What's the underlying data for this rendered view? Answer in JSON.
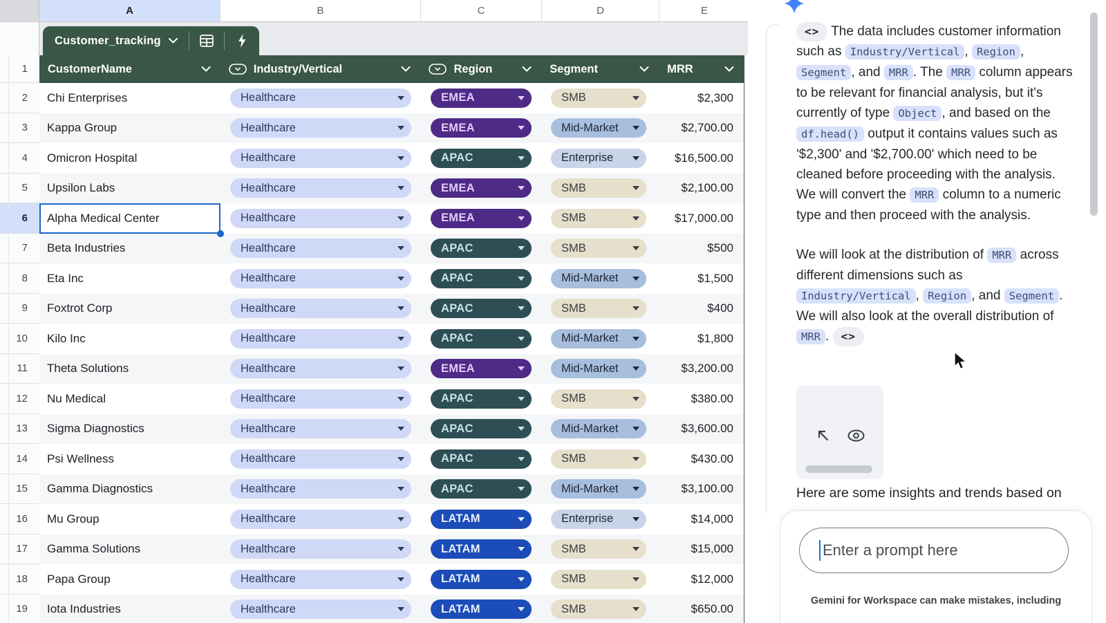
{
  "sheet": {
    "column_letters": [
      "A",
      "B",
      "C",
      "D",
      "E"
    ],
    "tab": {
      "name": "Customer_tracking"
    },
    "header": [
      {
        "label": "CustomerName",
        "chip_icon": false
      },
      {
        "label": "Industry/Vertical",
        "chip_icon": true
      },
      {
        "label": "Region",
        "chip_icon": true
      },
      {
        "label": "Segment",
        "chip_icon": false
      },
      {
        "label": "MRR",
        "chip_icon": false
      }
    ],
    "rows": [
      {
        "n": 2,
        "name": "Chi Enterprises",
        "industry": "Healthcare",
        "region": "EMEA",
        "segment": "SMB",
        "mrr": "$2,300"
      },
      {
        "n": 3,
        "name": "Kappa Group",
        "industry": "Healthcare",
        "region": "EMEA",
        "segment": "Mid-Market",
        "mrr": "$2,700.00"
      },
      {
        "n": 4,
        "name": "Omicron Hospital",
        "industry": "Healthcare",
        "region": "APAC",
        "segment": "Enterprise",
        "mrr": "$16,500.00"
      },
      {
        "n": 5,
        "name": "Upsilon Labs",
        "industry": "Healthcare",
        "region": "EMEA",
        "segment": "SMB",
        "mrr": "$2,100.00"
      },
      {
        "n": 6,
        "name": "Alpha Medical Center",
        "industry": "Healthcare",
        "region": "EMEA",
        "segment": "SMB",
        "mrr": "$17,000.00",
        "selected": true
      },
      {
        "n": 7,
        "name": "Beta Industries",
        "industry": "Healthcare",
        "region": "APAC",
        "segment": "SMB",
        "mrr": "$500"
      },
      {
        "n": 8,
        "name": "Eta Inc",
        "industry": "Healthcare",
        "region": "APAC",
        "segment": "Mid-Market",
        "mrr": "$1,500"
      },
      {
        "n": 9,
        "name": "Foxtrot Corp",
        "industry": "Healthcare",
        "region": "APAC",
        "segment": "SMB",
        "mrr": "$400"
      },
      {
        "n": 10,
        "name": "Kilo Inc",
        "industry": "Healthcare",
        "region": "APAC",
        "segment": "Mid-Market",
        "mrr": "$1,800"
      },
      {
        "n": 11,
        "name": "Theta Solutions",
        "industry": "Healthcare",
        "region": "EMEA",
        "segment": "Mid-Market",
        "mrr": "$3,200.00"
      },
      {
        "n": 12,
        "name": "Nu Medical",
        "industry": "Healthcare",
        "region": "APAC",
        "segment": "SMB",
        "mrr": "$380.00"
      },
      {
        "n": 13,
        "name": "Sigma Diagnostics",
        "industry": "Healthcare",
        "region": "APAC",
        "segment": "Mid-Market",
        "mrr": "$3,600.00"
      },
      {
        "n": 14,
        "name": "Psi Wellness",
        "industry": "Healthcare",
        "region": "APAC",
        "segment": "SMB",
        "mrr": "$430.00"
      },
      {
        "n": 15,
        "name": "Gamma Diagnostics",
        "industry": "Healthcare",
        "region": "APAC",
        "segment": "Mid-Market",
        "mrr": "$3,100.00"
      },
      {
        "n": 16,
        "name": "Mu Group",
        "industry": "Healthcare",
        "region": "LATAM",
        "segment": "Enterprise",
        "mrr": "$14,000"
      },
      {
        "n": 17,
        "name": "Gamma Solutions",
        "industry": "Healthcare",
        "region": "LATAM",
        "segment": "SMB",
        "mrr": "$15,000"
      },
      {
        "n": 18,
        "name": "Papa Group",
        "industry": "Healthcare",
        "region": "LATAM",
        "segment": "SMB",
        "mrr": "$12,000"
      },
      {
        "n": 19,
        "name": "Iota Industries",
        "industry": "Healthcare",
        "region": "LATAM",
        "segment": "SMB",
        "mrr": "$650.00"
      }
    ],
    "chip_colors": {
      "industry": {
        "Healthcare": {
          "bg": "#CFD8F6",
          "fg": "#2E3A5C"
        }
      },
      "region": {
        "EMEA": {
          "bg": "#4D2B86",
          "fg": "#E2CBF7"
        },
        "APAC": {
          "bg": "#2E4E55",
          "fg": "#C8E2E5"
        },
        "LATAM": {
          "bg": "#1B4CB8",
          "fg": "#E8F0FE"
        }
      },
      "segment": {
        "SMB": {
          "bg": "#E5DFCB",
          "fg": "#3A3D41"
        },
        "Mid-Market": {
          "bg": "#A7BEDD",
          "fg": "#1F2736"
        },
        "Enterprise": {
          "bg": "#C8D4E8",
          "fg": "#1F2736"
        }
      }
    },
    "theme_green": "#395646",
    "selection_blue": "#1765CC"
  },
  "sidebar": {
    "paragraphs": [
      [
        {
          "type": "chip",
          "value": "<>"
        },
        {
          "type": "text",
          "value": "  The data includes customer information such as "
        },
        {
          "type": "code",
          "value": "Industry/Vertical"
        },
        {
          "type": "text",
          "value": ", "
        },
        {
          "type": "code",
          "value": "Region"
        },
        {
          "type": "text",
          "value": ", "
        },
        {
          "type": "code",
          "value": "Segment"
        },
        {
          "type": "text",
          "value": ", and "
        },
        {
          "type": "code",
          "value": "MRR"
        },
        {
          "type": "text",
          "value": ". The "
        },
        {
          "type": "code",
          "value": "MRR"
        },
        {
          "type": "text",
          "value": " column appears to be relevant for financial analysis, but it's currently of type "
        },
        {
          "type": "code",
          "value": "Object"
        },
        {
          "type": "text",
          "value": ", and based on the "
        },
        {
          "type": "code",
          "value": "df.head()"
        },
        {
          "type": "text",
          "value": " output it contains values such as '$2,300' and '$2,700.00' which need to be cleaned before proceeding with the analysis. We will convert the "
        },
        {
          "type": "code",
          "value": "MRR"
        },
        {
          "type": "text",
          "value": " column to a numeric type and then proceed with the analysis."
        }
      ],
      [
        {
          "type": "text",
          "value": "We will look at the distribution of "
        },
        {
          "type": "code",
          "value": "MRR"
        },
        {
          "type": "text",
          "value": " across different dimensions such as "
        },
        {
          "type": "code",
          "value": "Industry/Vertical"
        },
        {
          "type": "text",
          "value": ", "
        },
        {
          "type": "code",
          "value": "Region"
        },
        {
          "type": "text",
          "value": ", and "
        },
        {
          "type": "code",
          "value": "Segment"
        },
        {
          "type": "text",
          "value": ". We will also look at the overall distribution of "
        },
        {
          "type": "code",
          "value": "MRR"
        },
        {
          "type": "text",
          "value": ".  "
        },
        {
          "type": "chip",
          "value": "<>"
        }
      ]
    ],
    "insights_teaser": "Here are some insights and trends based on",
    "prompt_placeholder": "Enter a prompt here",
    "disclaimer": "Gemini for Workspace can make mistakes, including"
  }
}
